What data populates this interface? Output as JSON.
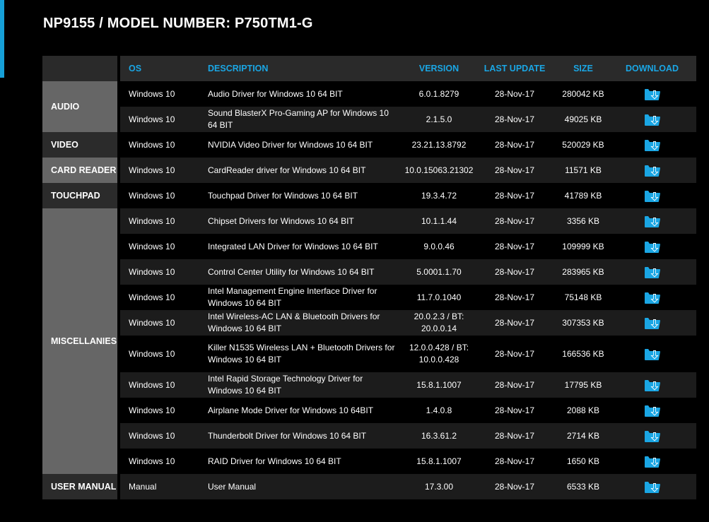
{
  "page": {
    "title": "NP9155 / MODEL NUMBER: P750TM1-G"
  },
  "colors": {
    "accent": "#1aa6e4",
    "cat_light": "#666666",
    "cat_dark": "#2b2b2b",
    "row_alt": "#1c1c1c"
  },
  "header": {
    "os": "OS",
    "description": "DESCRIPTION",
    "version": "VERSION",
    "last_update": "LAST UPDATE",
    "size": "SIZE",
    "download": "DOWNLOAD"
  },
  "categories": [
    {
      "name": "AUDIO",
      "rows": 2,
      "shade": "light"
    },
    {
      "name": "VIDEO",
      "rows": 1,
      "shade": "dark"
    },
    {
      "name": "CARD READER",
      "rows": 1,
      "shade": "light"
    },
    {
      "name": "TOUCHPAD",
      "rows": 1,
      "shade": "dark"
    },
    {
      "name": "MISCELLANIES",
      "rows": 10,
      "shade": "light"
    },
    {
      "name": "USER MANUAL",
      "rows": 1,
      "shade": "dark"
    }
  ],
  "rows": [
    {
      "os": "Windows 10",
      "description": "Audio Driver for Windows 10 64 BIT",
      "version": "6.0.1.8279",
      "date": "28-Nov-17",
      "size": "280042 KB"
    },
    {
      "os": "Windows 10",
      "description": "Sound BlasterX Pro-Gaming AP for Windows 10 64 BIT",
      "version": "2.1.5.0",
      "date": "28-Nov-17",
      "size": "49025 KB"
    },
    {
      "os": "Windows 10",
      "description": "NVIDIA Video Driver for Windows 10 64 BIT",
      "version": "23.21.13.8792",
      "date": "28-Nov-17",
      "size": "520029 KB"
    },
    {
      "os": "Windows 10",
      "description": "CardReader driver for Windows 10 64 BIT",
      "version": "10.0.15063.21302",
      "date": "28-Nov-17",
      "size": "11571 KB"
    },
    {
      "os": "Windows 10",
      "description": "Touchpad Driver for Windows 10 64 BIT",
      "version": "19.3.4.72",
      "date": "28-Nov-17",
      "size": "41789 KB"
    },
    {
      "os": "Windows 10",
      "description": "Chipset Drivers for Windows 10 64 BIT",
      "version": "10.1.1.44",
      "date": "28-Nov-17",
      "size": "3356 KB"
    },
    {
      "os": "Windows 10",
      "description": "Integrated LAN Driver for Windows 10 64 BIT",
      "version": "9.0.0.46",
      "date": "28-Nov-17",
      "size": "109999 KB"
    },
    {
      "os": "Windows 10",
      "description": "Control Center Utility for Windows 10 64 BIT",
      "version": "5.0001.1.70",
      "date": "28-Nov-17",
      "size": "283965 KB"
    },
    {
      "os": "Windows 10",
      "description": "Intel Management Engine Interface Driver for Windows 10 64 BIT",
      "version": "11.7.0.1040",
      "date": "28-Nov-17",
      "size": "75148 KB"
    },
    {
      "os": "Windows 10",
      "description": "Intel Wireless-AC LAN & Bluetooth Drivers for Windows 10 64 BIT",
      "version": "20.0.2.3 / BT: 20.0.0.14",
      "date": "28-Nov-17",
      "size": "307353 KB"
    },
    {
      "os": "Windows 10",
      "description": "Killer N1535 Wireless LAN + Bluetooth Drivers for Windows 10 64 BIT",
      "version": "12.0.0.428 / BT: 10.0.0.428",
      "date": "28-Nov-17",
      "size": "166536 KB"
    },
    {
      "os": "Windows 10",
      "description": "Intel Rapid Storage Technology Driver for Windows 10 64 BIT",
      "version": "15.8.1.1007",
      "date": "28-Nov-17",
      "size": "17795 KB"
    },
    {
      "os": "Windows 10",
      "description": "Airplane Mode Driver for Windows 10 64BIT",
      "version": "1.4.0.8",
      "date": "28-Nov-17",
      "size": "2088 KB"
    },
    {
      "os": "Windows 10",
      "description": "Thunderbolt Driver for Windows 10 64 BIT",
      "version": "16.3.61.2",
      "date": "28-Nov-17",
      "size": "2714 KB"
    },
    {
      "os": "Windows 10",
      "description": "RAID Driver for Windows 10 64 BIT",
      "version": "15.8.1.1007",
      "date": "28-Nov-17",
      "size": "1650 KB"
    },
    {
      "os": "Manual",
      "description": "User Manual",
      "version": "17.3.00",
      "date": "28-Nov-17",
      "size": "6533 KB"
    }
  ],
  "icons": {
    "download": "download-folder-icon"
  }
}
